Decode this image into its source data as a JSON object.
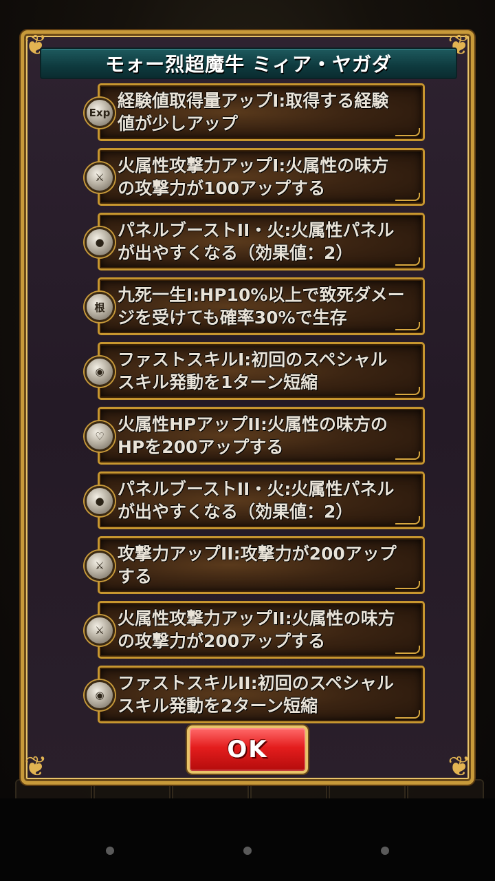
{
  "dialog": {
    "title": "モォー烈超魔牛 ミィア・ヤガダ",
    "ok_label": "OK"
  },
  "skills": [
    {
      "icon": "exp-icon",
      "icon_text": "Exp",
      "line1": "経験値取得量アップI:取得する経験",
      "line2": "値が少しアップ"
    },
    {
      "icon": "attack-up-icon",
      "icon_text": "",
      "line1": "火属性攻撃力アップI:火属性の味方",
      "line2": "の攻撃力が100アップする"
    },
    {
      "icon": "panel-orb-icon",
      "icon_text": "",
      "line1": "パネルブーストII・火:火属性パネル",
      "line2": "が出やすくなる（効果値：2）"
    },
    {
      "icon": "guts-icon",
      "icon_text": "根",
      "line1": "九死一生I:HP10%以上で致死ダメー",
      "line2": "ジを受けても確率30%で生存"
    },
    {
      "icon": "fast-skill-icon",
      "icon_text": "",
      "line1": "ファストスキルI:初回のスペシャル",
      "line2": "スキル発動を1ターン短縮"
    },
    {
      "icon": "hp-up-icon",
      "icon_text": "",
      "line1": "火属性HPアップII:火属性の味方の",
      "line2": "HPを200アップする"
    },
    {
      "icon": "panel-orb-icon",
      "icon_text": "",
      "line1": "パネルブーストII・火:火属性パネル",
      "line2": "が出やすくなる（効果値：2）"
    },
    {
      "icon": "attack-up-icon",
      "icon_text": "",
      "line1": "攻撃力アップII:攻撃力が200アップ",
      "line2": "する"
    },
    {
      "icon": "attack-up-icon",
      "icon_text": "",
      "line1": "火属性攻撃力アップII:火属性の味方",
      "line2": "の攻撃力が200アップする"
    },
    {
      "icon": "fast-skill-icon",
      "icon_text": "",
      "line1": "ファストスキルII:初回のスペシャル",
      "line2": "スキル発動を2ターン短縮"
    }
  ],
  "colors": {
    "frame_gold": "#c89a3a",
    "title_bar": "#0e3a3e",
    "ok_red": "#e41d1d"
  }
}
